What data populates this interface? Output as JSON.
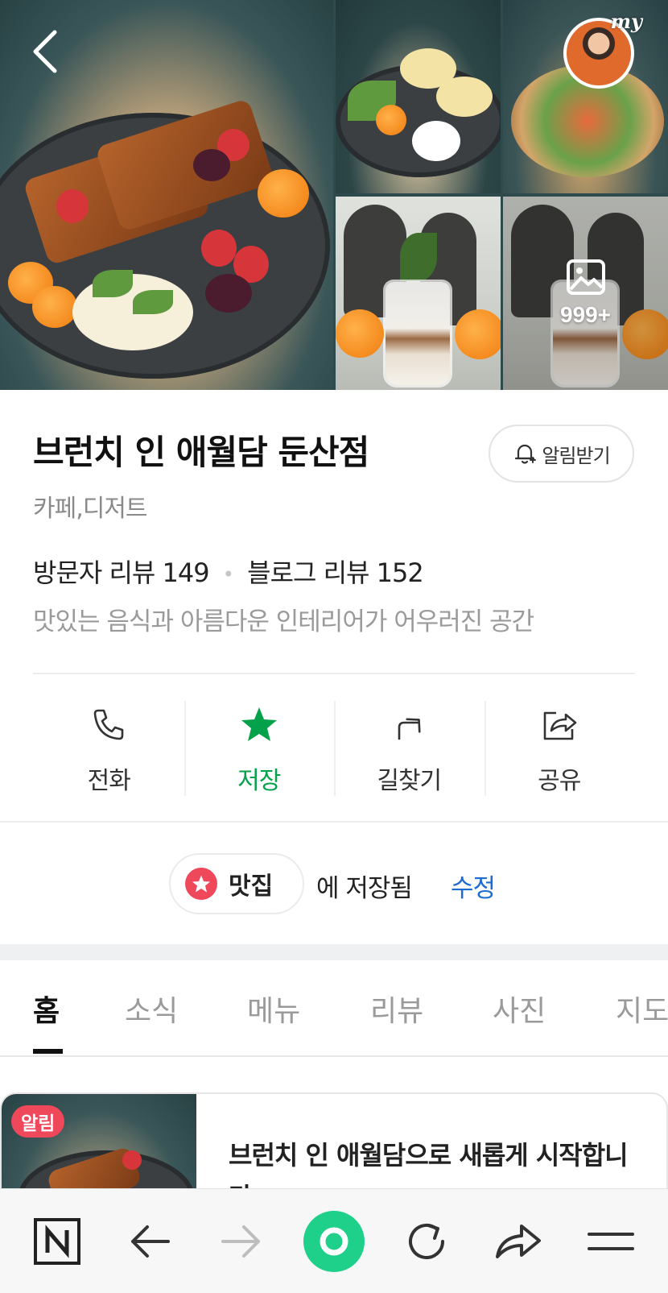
{
  "gallery": {
    "more_count": "999+",
    "my_badge": "my"
  },
  "place": {
    "name": "브런치 인 애월담 둔산점",
    "category": "카페,디저트",
    "visitor_review_label": "방문자 리뷰 149",
    "blog_review_label": "블로그 리뷰 152",
    "description": "맛있는 음식과 아름다운 인테리어가 어우러진 공간"
  },
  "alarm_button": {
    "label": "알림받기"
  },
  "actions": [
    {
      "id": "call",
      "label": "전화",
      "icon": "phone-icon"
    },
    {
      "id": "save",
      "label": "저장",
      "icon": "star-icon",
      "active": true
    },
    {
      "id": "directions",
      "label": "길찾기",
      "icon": "route-arrow-icon"
    },
    {
      "id": "share",
      "label": "공유",
      "icon": "share-icon"
    }
  ],
  "saved": {
    "folder": "맛집",
    "text": "에 저장됨",
    "edit_label": "수정"
  },
  "tabs": [
    "홈",
    "소식",
    "메뉴",
    "리뷰",
    "사진",
    "지도"
  ],
  "active_tab": "홈",
  "notice": {
    "badge": "알림",
    "title": "브런치 인 애월담으로 새롭게 시작합니다"
  },
  "colors": {
    "accent_green": "#03a24a",
    "link_blue": "#1e6ccf",
    "badge_red": "#f0485b"
  },
  "browser_bar": [
    "naver-home-icon",
    "back-arrow-icon",
    "forward-arrow-icon",
    "green-dot-icon",
    "refresh-icon",
    "share-arrow-icon",
    "menu-icon"
  ]
}
